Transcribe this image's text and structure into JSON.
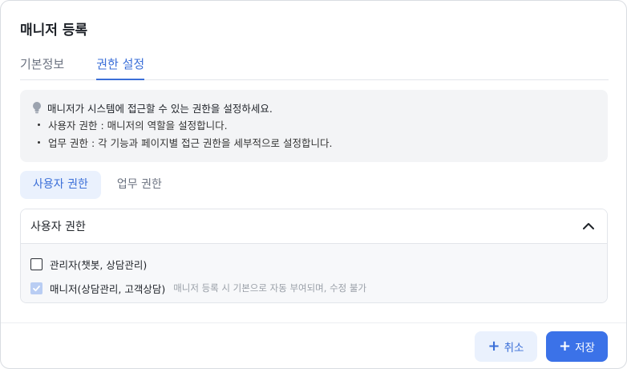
{
  "title": "매니저 등록",
  "tabs": [
    {
      "label": "기본정보",
      "active": false
    },
    {
      "label": "권한 설정",
      "active": true
    }
  ],
  "info": {
    "heading": "매니저가 시스템에 접근할 수 있는 권한을 설정하세요.",
    "lines": [
      "사용자 권한 : 매니저의 역할을 설정합니다.",
      "업무 권한 : 각 기능과 페이지별 접근 권한을 세부적으로 설정합니다."
    ]
  },
  "subtabs": [
    {
      "label": "사용자 권한",
      "active": true
    },
    {
      "label": "업무 권한",
      "active": false
    }
  ],
  "panel": {
    "title": "사용자 권한",
    "expanded": true,
    "options": [
      {
        "label": "관리자(챗봇, 상담관리)",
        "checked": false,
        "disabled": false,
        "hint": ""
      },
      {
        "label": "매니저(상담관리, 고객상담)",
        "checked": true,
        "disabled": true,
        "hint": "매니저 등록 시 기본으로 자동 부여되며, 수정 불가"
      }
    ]
  },
  "footer": {
    "cancel_label": "취소",
    "save_label": "저장"
  },
  "colors": {
    "accent": "#3b6fd8",
    "primary_button": "#3b72e8",
    "secondary_button_bg": "#eaf1fd",
    "disabled_check": "#b9cdf3"
  }
}
